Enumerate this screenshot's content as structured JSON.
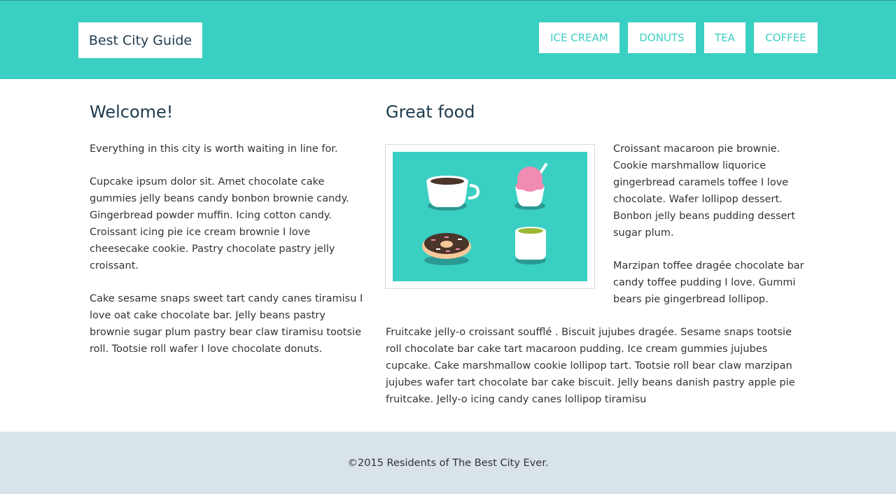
{
  "header": {
    "logo": "Best City Guide",
    "nav": [
      {
        "label": "ICE CREAM"
      },
      {
        "label": "DONUTS"
      },
      {
        "label": "TEA"
      },
      {
        "label": "COFFEE"
      }
    ]
  },
  "welcome": {
    "title": "Welcome!",
    "paragraphs": [
      "Everything in this city is worth waiting in line for.",
      "Cupcake ipsum dolor sit. Amet chocolate cake gummies jelly beans candy bonbon brownie candy. Gingerbread powder muffin. Icing cotton candy. Croissant icing pie ice cream brownie I love cheesecake cookie. Pastry chocolate pastry jelly croissant.",
      "Cake sesame snaps sweet tart candy canes tiramisu I love oat cake chocolate bar. Jelly beans pastry brownie sugar plum pastry bear claw tiramisu tootsie roll. Tootsie roll wafer I love chocolate donuts."
    ]
  },
  "food": {
    "title": "Great food",
    "side_paragraphs": [
      "Croissant macaroon pie brownie. Cookie marshmallow liquorice gingerbread caramels toffee I love chocolate. Wafer lollipop dessert. Bonbon jelly beans pudding dessert sugar plum.",
      "Marzipan toffee dragée chocolate bar candy toffee pudding I love. Gummi bears pie gingerbread lollipop."
    ],
    "bottom_paragraph": "Fruitcake jelly-o croissant soufflé . Biscuit jujubes dragée. Sesame snaps tootsie roll chocolate bar cake tart macaroon pudding. Ice cream gummies jujubes cupcake. Cake marshmallow cookie lollipop tart. Tootsie roll bear claw marzipan jujubes wafer tart chocolate bar cake biscuit. Jelly beans danish pastry apple pie fruitcake. Jelly-o icing candy canes lollipop tiramisu",
    "image_icons": [
      "coffee-cup-icon",
      "ice-cream-cup-icon",
      "donut-icon",
      "tea-cup-icon"
    ]
  },
  "footer": {
    "text": "©2015 Residents of The Best City Ever."
  },
  "colors": {
    "accent": "#3acfc3",
    "heading": "#1e3b4f",
    "footer_bg": "#d9e3ea"
  }
}
